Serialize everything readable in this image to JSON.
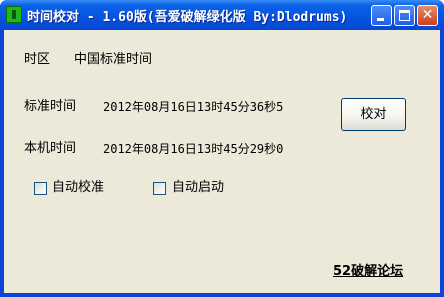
{
  "window": {
    "title": "时间校对 - 1.60版(吾爱破解绿化版 By:Dlodrums)",
    "close_glyph": "✕"
  },
  "timezone": {
    "label": "时区",
    "value": "中国标准时间"
  },
  "standard_time": {
    "label": "标准时间",
    "value": "2012年08月16日13时45分36秒5"
  },
  "local_time": {
    "label": "本机时间",
    "value": "2012年08月16日13时45分29秒0"
  },
  "sync_button": {
    "label": "校对"
  },
  "options": {
    "auto_sync": {
      "label": "自动校准",
      "checked": false
    },
    "auto_start": {
      "label": "自动启动",
      "checked": false
    }
  },
  "forum_link": {
    "label": "52破解论坛"
  }
}
